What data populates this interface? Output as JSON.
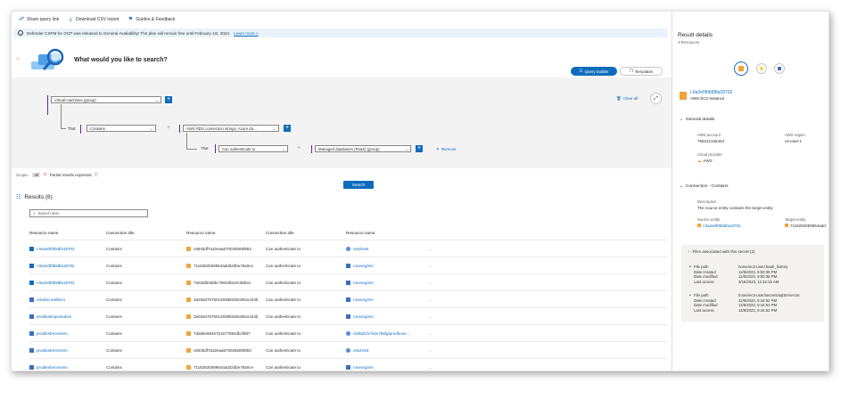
{
  "toolbar": {
    "share_label": "Share query link",
    "download_label": "Download CSV report",
    "guides_label": "Guides & Feedback"
  },
  "banner": {
    "text": "Defender CSPM for GCP was released to General Availability! The plan will remain free until February 1st, 2024.",
    "link": "Learn more >"
  },
  "search_header": {
    "title": "What would you like to search?",
    "query_builder_label": "Query builder",
    "templates_label": "Templates"
  },
  "query": {
    "clear_all": "Clear all",
    "row1": {
      "select": "Virtual machines (group)"
    },
    "row2": {
      "that": "That",
      "op": "Contains",
      "value": "AWS RDS connection strings, Azure da..."
    },
    "row3": {
      "that": "That",
      "op": "Can authenticate to",
      "value": "Managed databases (PaaS) (group)",
      "remove": "Remove"
    }
  },
  "scope": {
    "label": "Scope :",
    "value": "All",
    "warning": "Partial results expected"
  },
  "search_button": "Search",
  "results": {
    "title": "Results (8)",
    "search_placeholder": "Search item",
    "columns": [
      "Resource name",
      "Connection title",
      "Resource name",
      "Connection title",
      "Resource name",
      ""
    ],
    "rows": [
      {
        "r1": "i-0a2e0f0b58fa18702",
        "r1icon": "ec2",
        "c1": "Contains",
        "r2": "c854bdf7a32eaa670025b65f853",
        "c2": "Can authenticate to",
        "r3": "ortal-test",
        "r3icon": "key",
        "more": "..."
      },
      {
        "r1": "i-0a2e0f0b58fa18702",
        "r1icon": "ec2",
        "c1": "Contains",
        "r2": "7118282b59954add32dbe78a0ce",
        "c2": "Can authenticate to",
        "r3": "roneorg/vm",
        "r3icon": "vm",
        "more": "..."
      },
      {
        "r1": "i-0a2e0f0b58fa18702",
        "r1icon": "ec2",
        "c1": "Contains",
        "r2": "7a03af5338bc79019fac0c38531",
        "c2": "Can authenticate to",
        "r3": "roneorg/vm",
        "r3icon": "vm",
        "more": "..."
      },
      {
        "r1": "ortalsecretdbvm",
        "r1icon": "vm",
        "c1": "Contains",
        "r2": "3a03a076750128389335c80a1424b",
        "c2": "Can authenticate to",
        "r3": "roneorg/vm",
        "r3icon": "vm",
        "more": "..."
      },
      {
        "r1": "prodtestexposedvm",
        "r1icon": "vm",
        "c1": "Contains",
        "r2": "3a03a076750128389335c80a1424b",
        "c2": "Can authenticate to",
        "r3": "roneorg/vm",
        "r3icon": "vm",
        "more": "..."
      },
      {
        "r1": "prodtestrecentvm",
        "r1icon": "vm",
        "c1": "Contains",
        "r2": "7ddd6e96467b1677884dbcf887",
        "c2": "Can authenticate to",
        "r3": "c5d5d1f17d4c756fg/prodhone...",
        "r3icon": "key",
        "more": "..."
      },
      {
        "r1": "prodtestrecentvm",
        "r1icon": "vm",
        "c1": "Contains",
        "r2": "c854bdf7a32eaa670025b65f853",
        "c2": "Can authenticate to",
        "r3": "ortal-test",
        "r3icon": "key",
        "more": "..."
      },
      {
        "r1": "prodtestrecentvm",
        "r1icon": "vm",
        "c1": "Contains",
        "r2": "7118282b59954add32dbe78a0ce",
        "c2": "Can authenticate to",
        "r3": "roneorg/vm",
        "r3icon": "vm",
        "more": "..."
      }
    ]
  },
  "details": {
    "title": "Result details",
    "subtitle": "3 Resources",
    "resource_name": "i-0a2e0f0b58fa18702",
    "resource_type": "AWS EC2 Instance",
    "general_title": "General details",
    "aws_account_label": "AWS account",
    "aws_account_value": "766221345453",
    "aws_region_label": "AWS region",
    "aws_region_value": "us-east-1",
    "cloud_provider_label": "Cloud provider",
    "cloud_provider_value": "AWS",
    "connection_title": "Connection - Contains",
    "description_label": "Description",
    "description_value": "The source entity contains the target entity",
    "source_label": "Source entity",
    "source_value": "i-0a2e0f0b58fa18702",
    "target_label": "Target entity",
    "target_value": "71182820b9954add",
    "files_title": "Files associated with this secret (2)",
    "files": [
      {
        "path_label": "File path",
        "path": "home/ec2-user/.bash_history",
        "created_label": "Date created",
        "created": "11/8/2023, 9:50:39 PM",
        "modified_label": "Date modified",
        "modified": "11/8/2023, 9:50:39 PM",
        "access_label": "Last access",
        "access": "3/16/2023, 11:22:15 AM"
      },
      {
        "path_label": "File path",
        "path": "home/ec2-user/secrets/sqlServer.txt",
        "created_label": "Date created",
        "created": "11/8/2023, 9:44:52 PM",
        "modified_label": "Date modified",
        "modified": "11/8/2023, 9:44:52 PM",
        "access_label": "Last access",
        "access": "11/8/2023, 9:44:52 PM"
      }
    ]
  }
}
